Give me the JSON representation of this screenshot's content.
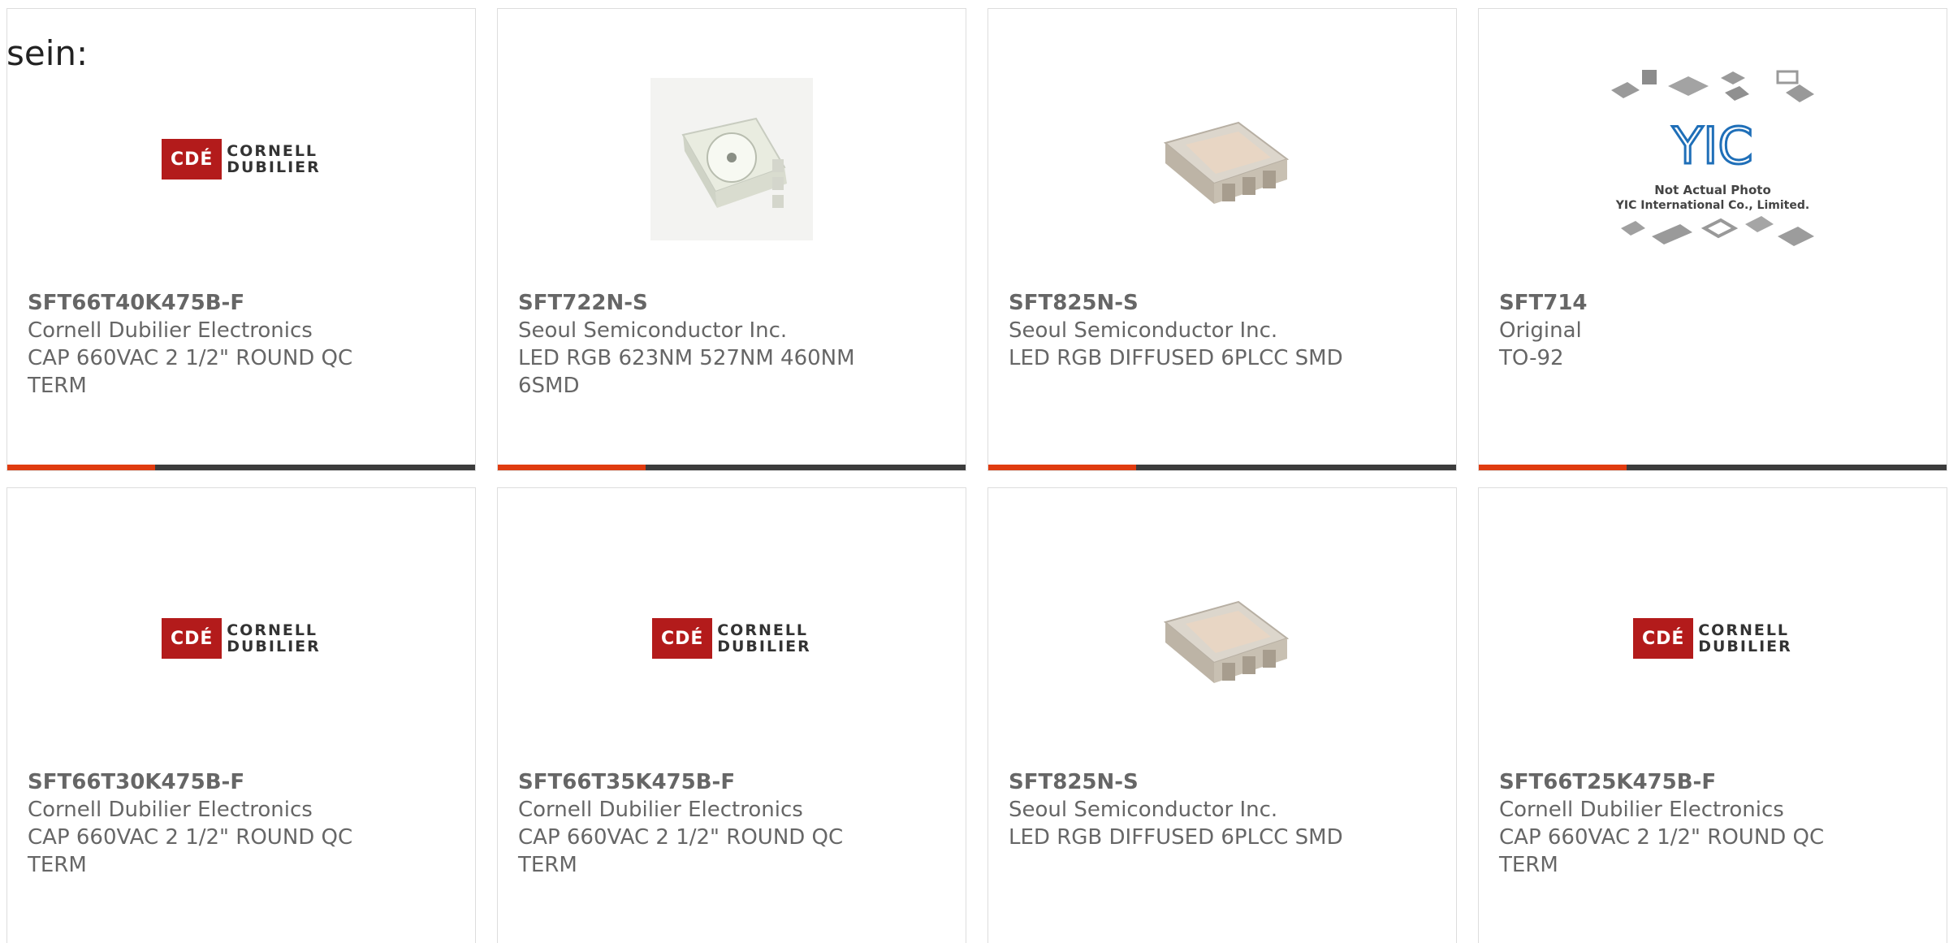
{
  "intro_text": "sein:",
  "products": [
    {
      "part_number": "SFT66T40K475B-F",
      "manufacturer": "Cornell Dubilier Electronics",
      "description": "CAP 660VAC 2 1/2\" ROUND QC TERM",
      "image": "cde-logo"
    },
    {
      "part_number": "SFT722N-S",
      "manufacturer": "Seoul Semiconductor Inc.",
      "description": "LED RGB 623NM 527NM 460NM 6SMD",
      "image": "led-smd-white"
    },
    {
      "part_number": "SFT825N-S",
      "manufacturer": "Seoul Semiconductor Inc.",
      "description": "LED RGB DIFFUSED 6PLCC SMD",
      "image": "led-smd-diffused"
    },
    {
      "part_number": "SFT714",
      "manufacturer": "Original",
      "description": "TO-92",
      "image": "yic-placeholder",
      "image_caption_1": "Not Actual Photo",
      "image_caption_2": "YIC International Co., Limited."
    },
    {
      "part_number": "SFT66T30K475B-F",
      "manufacturer": "Cornell Dubilier Electronics",
      "description": "CAP 660VAC 2 1/2\" ROUND QC TERM",
      "image": "cde-logo"
    },
    {
      "part_number": "SFT66T35K475B-F",
      "manufacturer": "Cornell Dubilier Electronics",
      "description": "CAP 660VAC 2 1/2\" ROUND QC TERM",
      "image": "cde-logo"
    },
    {
      "part_number": "SFT825N-S",
      "manufacturer": "Seoul Semiconductor Inc.",
      "description": "LED RGB DIFFUSED 6PLCC SMD",
      "image": "led-smd-diffused"
    },
    {
      "part_number": "SFT66T25K475B-F",
      "manufacturer": "Cornell Dubilier Electronics",
      "description": "CAP 660VAC 2 1/2\" ROUND QC TERM",
      "image": "cde-logo"
    }
  ],
  "cde_logo": {
    "mark": "CDÉ",
    "line1": "CORNELL",
    "line2": "DUBILIER"
  },
  "colors": {
    "accent": "#e03c10",
    "bar": "#3c3c3c",
    "text": "#666666",
    "cde_red": "#b31b1b"
  }
}
